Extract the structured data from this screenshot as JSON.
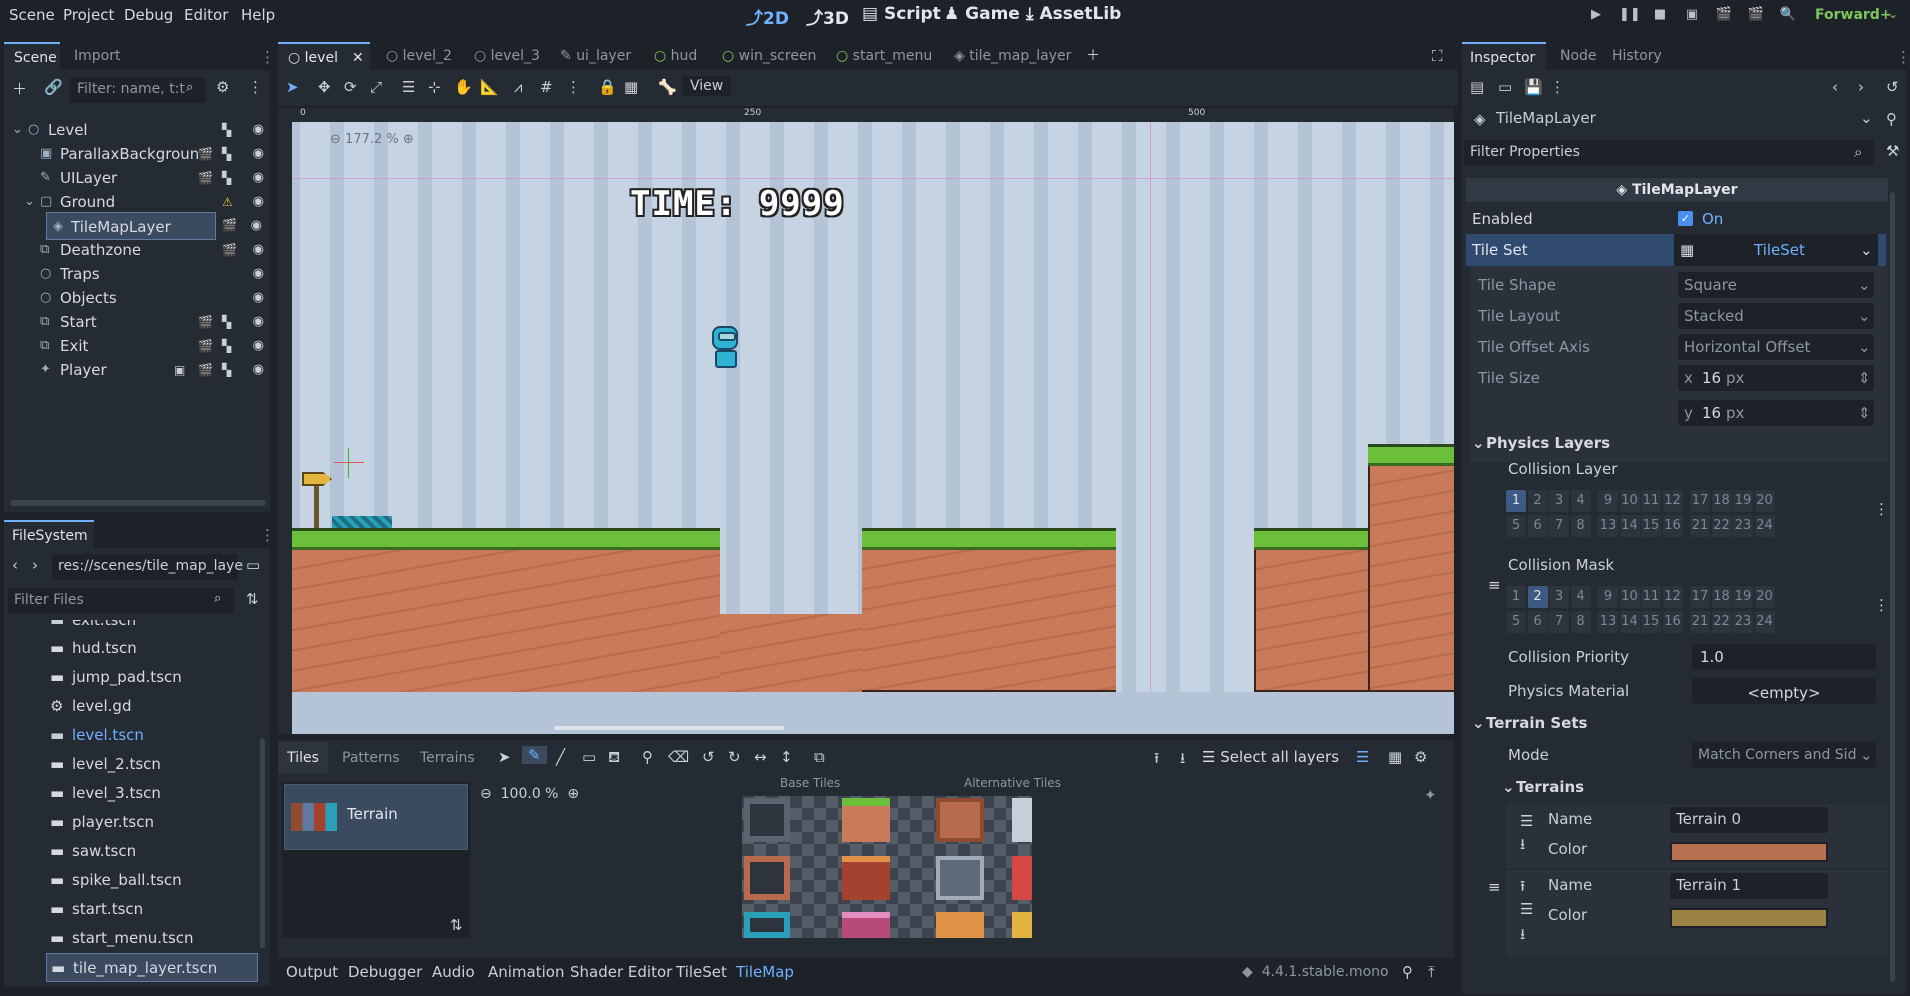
{
  "menu": [
    "Scene",
    "Project",
    "Debug",
    "Editor",
    "Help"
  ],
  "workspaces": [
    "2D",
    "3D",
    "Script",
    "Game",
    "AssetLib"
  ],
  "renderer": "Forward+",
  "left_tabs": {
    "scene": "Scene",
    "import": "Import"
  },
  "scene_filter_placeholder": "Filter: name, t:t",
  "scene_tree": [
    {
      "label": "Level",
      "depth": 0,
      "icon": "node-icon"
    },
    {
      "label": "ParallaxBackgroun",
      "depth": 1,
      "icon": "parallax-icon"
    },
    {
      "label": "UILayer",
      "depth": 1,
      "icon": "canvas-layer-icon"
    },
    {
      "label": "Ground",
      "depth": 1,
      "icon": "node2d-icon"
    },
    {
      "label": "TileMapLayer",
      "depth": 2,
      "icon": "tilemap-icon"
    },
    {
      "label": "Deathzone",
      "depth": 1,
      "icon": "area-icon"
    },
    {
      "label": "Traps",
      "depth": 1,
      "icon": "node-icon"
    },
    {
      "label": "Objects",
      "depth": 1,
      "icon": "node-icon"
    },
    {
      "label": "Start",
      "depth": 1,
      "icon": "area-icon"
    },
    {
      "label": "Exit",
      "depth": 1,
      "icon": "area-icon"
    },
    {
      "label": "Player",
      "depth": 1,
      "icon": "character-icon"
    }
  ],
  "filesystem": {
    "title": "FileSystem",
    "path": "res://scenes/tile_map_laye",
    "filter_placeholder": "Filter Files",
    "files": [
      "exit.tscn",
      "hud.tscn",
      "jump_pad.tscn",
      "level.gd",
      "level.tscn",
      "level_2.tscn",
      "level_3.tscn",
      "player.tscn",
      "saw.tscn",
      "spike_ball.tscn",
      "start.tscn",
      "start_menu.tscn",
      "tile_map_layer.tscn"
    ]
  },
  "scene_tabs": [
    "level",
    "level_2",
    "level_3",
    "ui_layer",
    "hud",
    "win_screen",
    "start_menu",
    "tile_map_layer"
  ],
  "viewport": {
    "zoom": "177.2 %",
    "view_menu": "View",
    "time_label": "TIME: 9999",
    "ruler": [
      "0",
      "250",
      "500"
    ]
  },
  "tilemap_panel": {
    "tabs": [
      "Tiles",
      "Patterns",
      "Terrains"
    ],
    "select_all": "Select all layers",
    "tileset_item": "Terrain",
    "zoom": "100.0 %",
    "base_tiles": "Base Tiles",
    "alt_tiles": "Alternative Tiles"
  },
  "bottom_tabs": [
    "Output",
    "Debugger",
    "Audio",
    "Animation",
    "Shader Editor",
    "TileSet",
    "TileMap"
  ],
  "version": "4.4.1.stable.mono",
  "inspector": {
    "tabs": [
      "Inspector",
      "Node",
      "History"
    ],
    "node_name": "TileMapLayer",
    "filter_placeholder": "Filter Properties",
    "section_title": "TileMapLayer",
    "enabled": {
      "label": "Enabled",
      "value": "On"
    },
    "tile_set": {
      "label": "Tile Set",
      "value": "TileSet"
    },
    "tile_shape": {
      "label": "Tile Shape",
      "value": "Square"
    },
    "tile_layout": {
      "label": "Tile Layout",
      "value": "Stacked"
    },
    "tile_offset_axis": {
      "label": "Tile Offset Axis",
      "value": "Horizontal Offset"
    },
    "tile_size": {
      "label": "Tile Size",
      "x": "16",
      "y": "16",
      "unit": "px"
    },
    "physics_layers": "Physics Layers",
    "collision_layer": "Collision Layer",
    "collision_mask": "Collision Mask",
    "layer_bits_top": [
      "1",
      "2",
      "3",
      "4",
      "9",
      "10",
      "11",
      "12",
      "17",
      "18",
      "19",
      "20"
    ],
    "layer_bits_bottom": [
      "5",
      "6",
      "7",
      "8",
      "13",
      "14",
      "15",
      "16",
      "21",
      "22",
      "23",
      "24"
    ],
    "collision_priority": {
      "label": "Collision Priority",
      "value": "1.0"
    },
    "physics_material": {
      "label": "Physics Material",
      "value": "<empty>"
    },
    "terrain_sets": "Terrain Sets",
    "mode": {
      "label": "Mode",
      "value": "Match Corners and Sid"
    },
    "terrains": "Terrains",
    "terrain_list": [
      {
        "name_label": "Name",
        "name": "Terrain 0",
        "color_label": "Color",
        "color": "#b87150"
      },
      {
        "name_label": "Name",
        "name": "Terrain 1",
        "color_label": "Color",
        "color": "#9b8245"
      }
    ]
  }
}
